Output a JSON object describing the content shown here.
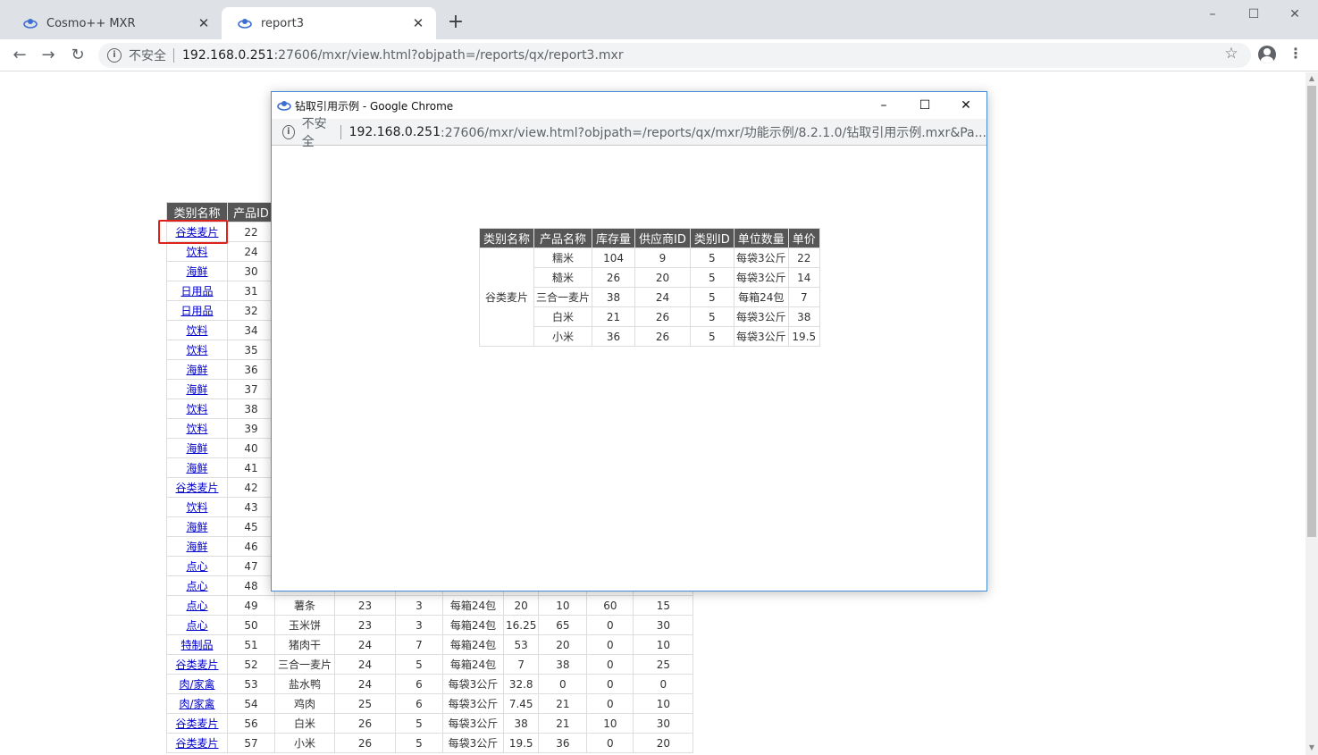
{
  "browser": {
    "tabs": [
      {
        "title": "Cosmo++ MXR",
        "active": false
      },
      {
        "title": "report3",
        "active": true
      }
    ],
    "new_tab_label": "+",
    "window_controls": {
      "minimize": "–",
      "maximize": "☐",
      "close": "✕"
    },
    "nav": {
      "back": "←",
      "forward": "→",
      "reload": "↻"
    },
    "security_label": "不安全",
    "url_host": "192.168.0.251",
    "url_rest": ":27606/mxr/view.html?objpath=/reports/qx/report3.mxr",
    "star_icon": "☆",
    "menu_icon": "⋮",
    "accent_color": "#dee1e6"
  },
  "report": {
    "headers": [
      "类别名称",
      "产品ID"
    ],
    "rows": [
      [
        "谷类麦片",
        "22",
        "",
        "",
        "",
        "",
        "",
        "",
        "",
        ""
      ],
      [
        "饮料",
        "24",
        "",
        "",
        "",
        "",
        "",
        "",
        "",
        ""
      ],
      [
        "海鲜",
        "30",
        "",
        "",
        "",
        "",
        "",
        "",
        "",
        ""
      ],
      [
        "日用品",
        "31",
        "",
        "",
        "",
        "",
        "",
        "",
        "",
        ""
      ],
      [
        "日用品",
        "32",
        "",
        "",
        "",
        "",
        "",
        "",
        "",
        ""
      ],
      [
        "饮料",
        "34",
        "",
        "",
        "",
        "",
        "",
        "",
        "",
        ""
      ],
      [
        "饮料",
        "35",
        "",
        "",
        "",
        "",
        "",
        "",
        "",
        ""
      ],
      [
        "海鲜",
        "36",
        "",
        "",
        "",
        "",
        "",
        "",
        "",
        ""
      ],
      [
        "海鲜",
        "37",
        "",
        "",
        "",
        "",
        "",
        "",
        "",
        ""
      ],
      [
        "饮料",
        "38",
        "",
        "",
        "",
        "",
        "",
        "",
        "",
        ""
      ],
      [
        "饮料",
        "39",
        "",
        "",
        "",
        "",
        "",
        "",
        "",
        ""
      ],
      [
        "海鲜",
        "40",
        "",
        "",
        "",
        "",
        "",
        "",
        "",
        ""
      ],
      [
        "海鲜",
        "41",
        "",
        "",
        "",
        "",
        "",
        "",
        "",
        ""
      ],
      [
        "谷类麦片",
        "42",
        "",
        "",
        "",
        "",
        "",
        "",
        "",
        ""
      ],
      [
        "饮料",
        "43",
        "",
        "",
        "",
        "",
        "",
        "",
        "",
        ""
      ],
      [
        "海鲜",
        "45",
        "",
        "",
        "",
        "",
        "",
        "",
        "",
        ""
      ],
      [
        "海鲜",
        "46",
        "",
        "",
        "",
        "",
        "",
        "",
        "",
        ""
      ],
      [
        "点心",
        "47",
        "",
        "",
        "",
        "",
        "",
        "",
        "",
        ""
      ],
      [
        "点心",
        "48",
        "",
        "",
        "",
        "",
        "",
        "",
        "",
        ""
      ],
      [
        "点心",
        "49",
        "薯条",
        "23",
        "3",
        "每箱24包",
        "20",
        "10",
        "60",
        "15"
      ],
      [
        "点心",
        "50",
        "玉米饼",
        "23",
        "3",
        "每箱24包",
        "16.25",
        "65",
        "0",
        "30"
      ],
      [
        "特制品",
        "51",
        "猪肉干",
        "24",
        "7",
        "每箱24包",
        "53",
        "20",
        "0",
        "10"
      ],
      [
        "谷类麦片",
        "52",
        "三合一麦片",
        "24",
        "5",
        "每箱24包",
        "7",
        "38",
        "0",
        "25"
      ],
      [
        "肉/家禽",
        "53",
        "盐水鸭",
        "24",
        "6",
        "每袋3公斤",
        "32.8",
        "0",
        "0",
        "0"
      ],
      [
        "肉/家禽",
        "54",
        "鸡肉",
        "25",
        "6",
        "每袋3公斤",
        "7.45",
        "21",
        "0",
        "10"
      ],
      [
        "谷类麦片",
        "56",
        "白米",
        "26",
        "5",
        "每袋3公斤",
        "38",
        "21",
        "10",
        "30"
      ],
      [
        "谷类麦片",
        "57",
        "小米",
        "26",
        "5",
        "每袋3公斤",
        "19.5",
        "36",
        "0",
        "20"
      ]
    ],
    "highlight_color": "#e0201b"
  },
  "popup": {
    "title": "钻取引用示例 - Google Chrome",
    "security_label": "不安全",
    "url_host": "192.168.0.251",
    "url_rest": ":27606/mxr/view.html?objpath=/reports/qx/mxr/功能示例/8.2.1.0/钻取引用示例.mxr&Pa...",
    "table": {
      "headers": [
        "类别名称",
        "产品名称",
        "库存量",
        "供应商ID",
        "类别ID",
        "单位数量",
        "单价"
      ],
      "category": "谷类麦片",
      "rows": [
        [
          "糯米",
          "104",
          "9",
          "5",
          "每袋3公斤",
          "22"
        ],
        [
          "糙米",
          "26",
          "20",
          "5",
          "每袋3公斤",
          "14"
        ],
        [
          "三合一麦片",
          "38",
          "24",
          "5",
          "每箱24包",
          "7"
        ],
        [
          "白米",
          "21",
          "26",
          "5",
          "每袋3公斤",
          "38"
        ],
        [
          "小米",
          "36",
          "26",
          "5",
          "每袋3公斤",
          "19.5"
        ]
      ]
    }
  }
}
